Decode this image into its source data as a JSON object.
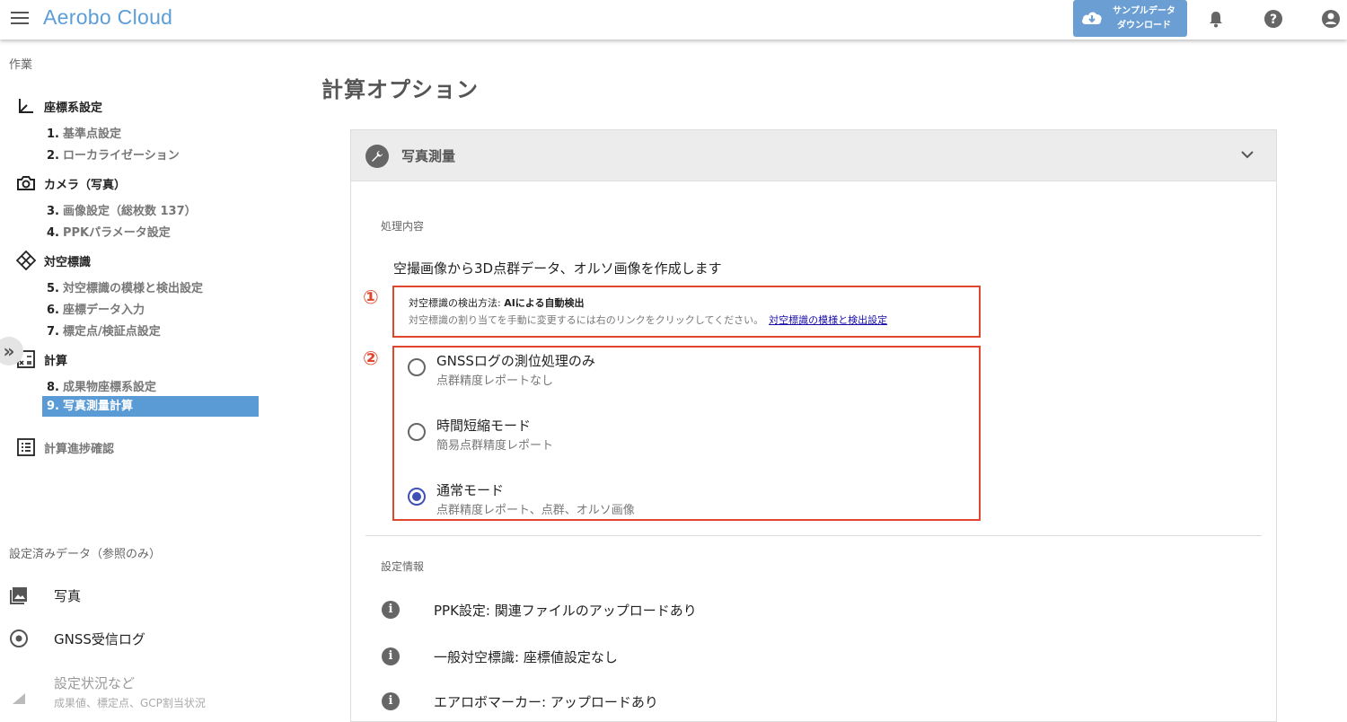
{
  "app": {
    "title": "Aerobo Cloud"
  },
  "header": {
    "sample_button_line1": "サンプルデータ",
    "sample_button_line2": "ダウンロード"
  },
  "sidebar": {
    "work_label": "作業",
    "groups": [
      {
        "label": "座標系設定",
        "icon": "axis-icon"
      },
      {
        "label": "カメラ（写真）",
        "icon": "camera-icon"
      },
      {
        "label": "対空標識",
        "icon": "target-diamond-icon"
      },
      {
        "label": "計算",
        "icon": "calculation-icon"
      }
    ],
    "steps": [
      {
        "num": "1.",
        "label": "基準点設定"
      },
      {
        "num": "2.",
        "label": "ローカライゼーション"
      },
      {
        "num": "3.",
        "label": "画像設定（総枚数 137）"
      },
      {
        "num": "4.",
        "label": "PPKパラメータ設定"
      },
      {
        "num": "5.",
        "label": "対空標識の模様と検出設定"
      },
      {
        "num": "6.",
        "label": "座標データ入力"
      },
      {
        "num": "7.",
        "label": "標定点/検証点設定"
      },
      {
        "num": "8.",
        "label": "成果物座標系設定"
      },
      {
        "num": "9.",
        "label": "写真測量計算"
      }
    ],
    "progress_label": "計算進捗確認",
    "expand_glyph": "»",
    "ref_label": "設定済みデータ（参照のみ）",
    "ref_items": [
      {
        "label": "写真",
        "icon": "photo-icon"
      },
      {
        "label": "GNSS受信ログ",
        "icon": "gnss-icon"
      },
      {
        "label": "設定状況など",
        "icon": "settings-status-icon"
      }
    ],
    "ref_item_sub": "成果値、標定点、GCP割当状況"
  },
  "main": {
    "page_title": "計算オプション",
    "panel_title": "写真測量",
    "process_label": "処理内容",
    "description": "空撮画像から3D点群データ、オルソ画像を作成します",
    "marker1": "①",
    "marker2": "②",
    "detection_prefix": "対空標識の検出方法: ",
    "detection_value": "AIによる自動検出",
    "detection_note": "対空標識の割り当てを手動に変更するには右のリンクをクリックしてください。",
    "detection_link": "対空標識の模様と検出設定",
    "options": [
      {
        "title": "GNSSログの測位処理のみ",
        "sub": "点群精度レポートなし",
        "checked": false
      },
      {
        "title": "時間短縮モード",
        "sub": "簡易点群精度レポート",
        "checked": false
      },
      {
        "title": "通常モード",
        "sub": "点群精度レポート、点群、オルソ画像",
        "checked": true
      }
    ],
    "settings_label": "設定情報",
    "info_icon_glyph": "i",
    "info_rows": [
      "PPK設定: 関連ファイルのアップロードあり",
      "一般対空標識: 座標値設定なし",
      "エアロボマーカー: アップロードあり"
    ]
  },
  "colors": {
    "brand": "#5d9ed6",
    "active_step": "#5b9bd5",
    "annotation_red": "#e0462e",
    "radio_selected": "#3f51b5"
  }
}
